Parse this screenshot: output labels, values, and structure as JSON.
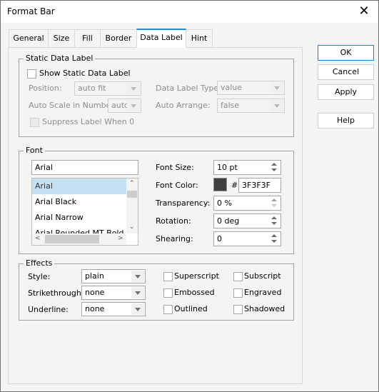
{
  "window": {
    "title": "Format Bar",
    "close_icon": "close-icon"
  },
  "tabs": [
    {
      "label": "General",
      "active": false
    },
    {
      "label": "Size",
      "active": false
    },
    {
      "label": "Fill",
      "active": false
    },
    {
      "label": "Border",
      "active": false
    },
    {
      "label": "Data Label",
      "active": true
    },
    {
      "label": "Hint",
      "active": false
    }
  ],
  "buttons": {
    "ok": "OK",
    "cancel": "Cancel",
    "apply": "Apply",
    "help": "Help"
  },
  "static_data_label": {
    "group_label": "Static Data Label",
    "show_label": "Show Static Data Label",
    "show_checked": false,
    "position_label": "Position:",
    "position_value": "auto fit",
    "data_label_type_label": "Data Label Type:",
    "data_label_type_value": "value",
    "auto_scale_label": "Auto Scale in Number:",
    "auto_scale_value": "auto",
    "auto_arrange_label": "Auto Arrange:",
    "auto_arrange_value": "false",
    "suppress_label": "Suppress Label When 0",
    "suppress_checked": false
  },
  "font": {
    "group_label": "Font",
    "name_value": "Arial",
    "font_list": [
      "Arial",
      "Arial Black",
      "Arial Narrow",
      "Arial Rounded MT Bold"
    ],
    "selected_font": "Arial",
    "font_size_label": "Font Size:",
    "font_size_value": "10 pt",
    "font_color_label": "Font Color:",
    "font_color_hash": "#",
    "font_color_value": "3F3F3F",
    "font_color_swatch": "#3f3f3f",
    "transparency_label": "Transparency:",
    "transparency_value": "0 %",
    "rotation_label": "Rotation:",
    "rotation_value": "0 deg",
    "shearing_label": "Shearing:",
    "shearing_value": "0"
  },
  "effects": {
    "group_label": "Effects",
    "style_label": "Style:",
    "style_value": "plain",
    "strikethrough_label": "Strikethrough:",
    "strikethrough_value": "none",
    "underline_label": "Underline:",
    "underline_value": "none",
    "superscript": "Superscript",
    "subscript": "Subscript",
    "embossed": "Embossed",
    "engraved": "Engraved",
    "outlined": "Outlined",
    "shadowed": "Shadowed"
  }
}
